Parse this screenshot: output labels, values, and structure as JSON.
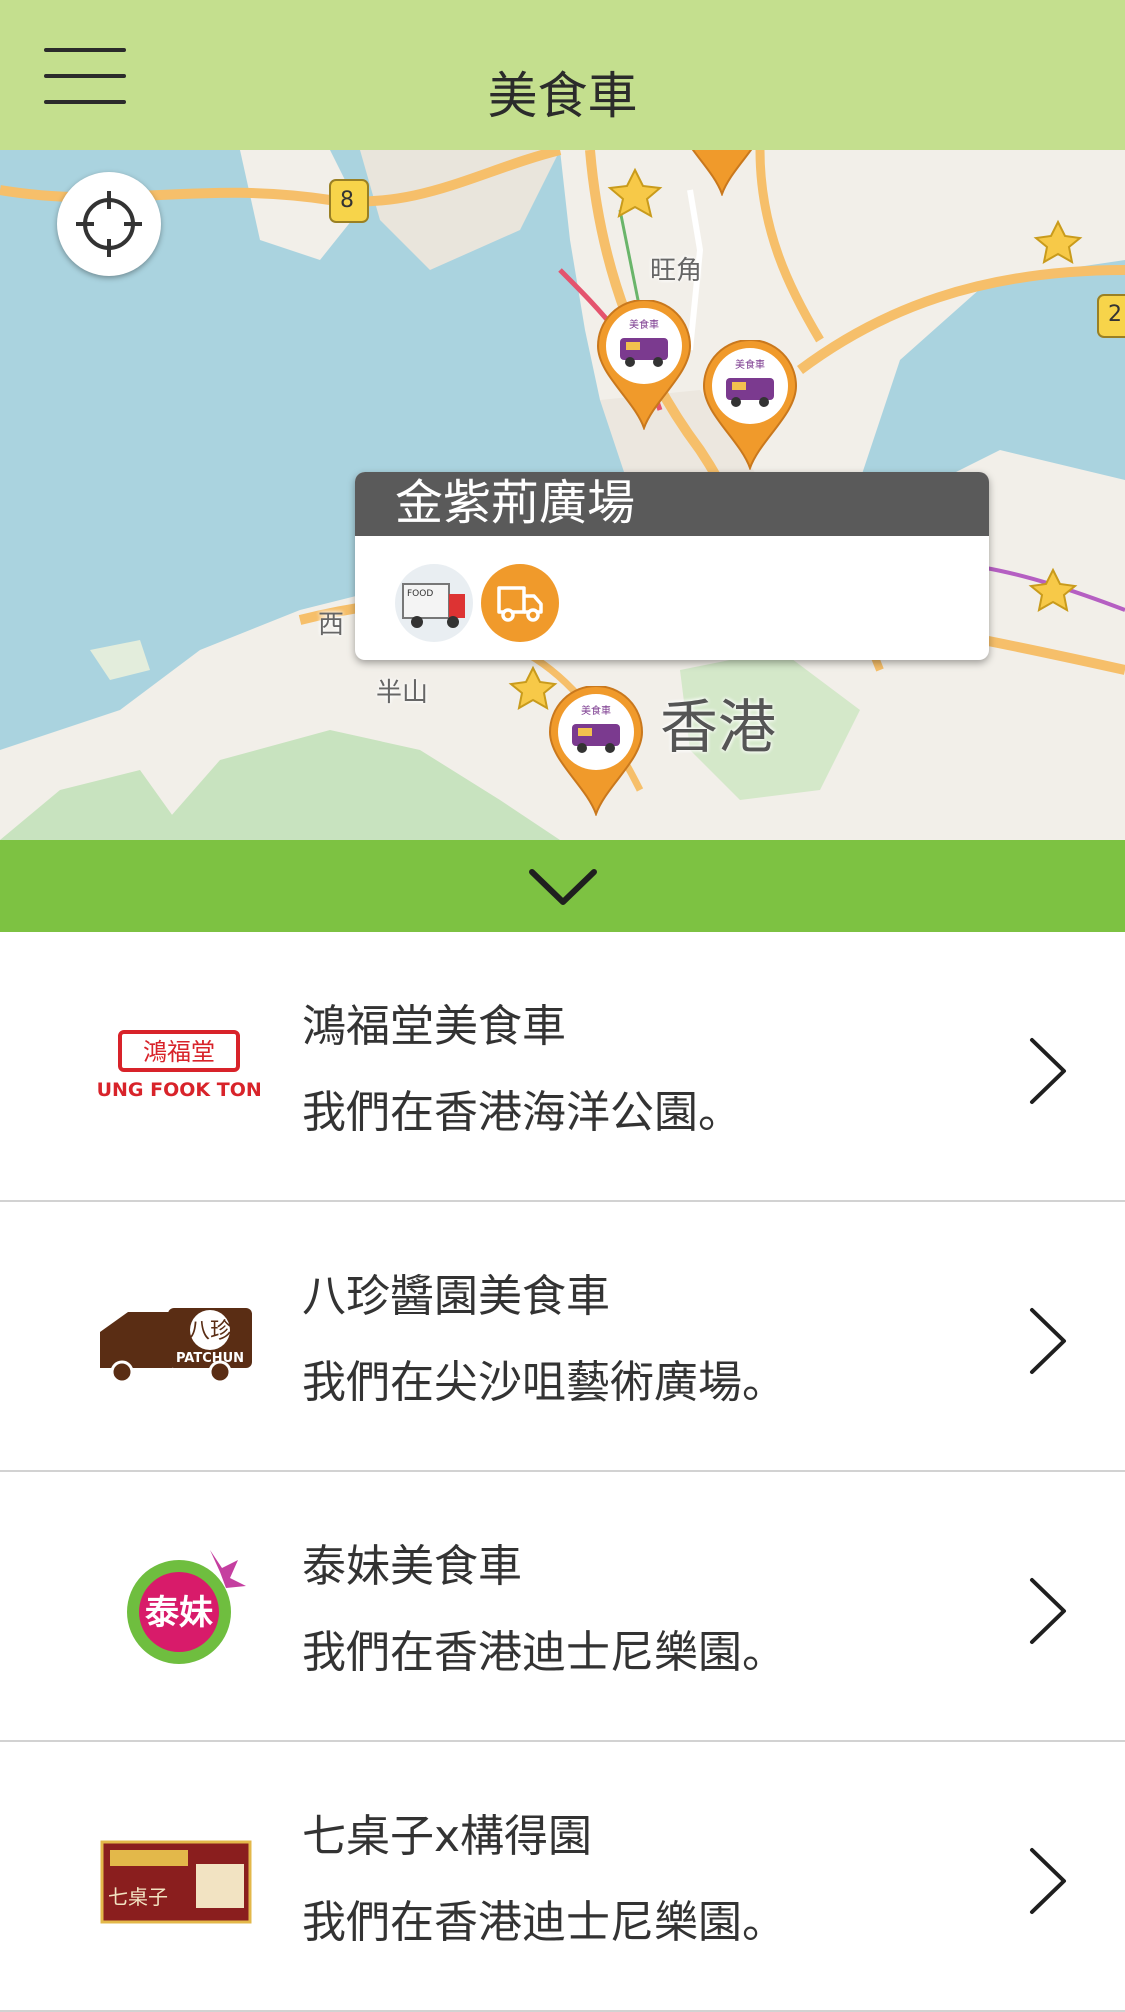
{
  "header": {
    "title": "美食車"
  },
  "map": {
    "place_labels": {
      "wang_kok": "旺角",
      "sai": "西",
      "bun_shan": "半山",
      "hong_kong": "香港"
    },
    "road_shield": "8",
    "road_shield_2": "2",
    "popup": {
      "title": "金紫荊廣場"
    },
    "colors": {
      "water": "#aad3df",
      "land": "#f2efe9",
      "park": "#c8e3bf",
      "road": "#f6bf6a",
      "pin": "#f09a2b"
    }
  },
  "toggle": {
    "icon": "chevron-down-icon"
  },
  "list": {
    "items": [
      {
        "name": "鴻福堂美食車",
        "location": "我們在香港海洋公園。",
        "logo": "hung-fook-tong-logo",
        "logo_text": "HUNG FOOK TONG"
      },
      {
        "name": "八珍醬園美食車",
        "location": "我們在尖沙咀藝術廣場。",
        "logo": "patchun-logo",
        "logo_text": "PATCHUN"
      },
      {
        "name": "泰妹美食車",
        "location": "我們在香港迪士尼樂園。",
        "logo": "thai-mui-logo",
        "logo_text": "泰妹"
      },
      {
        "name": "七桌子x構得園",
        "location": "我們在香港迪士尼樂園。",
        "logo": "seven-tables-logo",
        "logo_text": "七桌子"
      }
    ]
  },
  "colors": {
    "header_bg": "#c4df8e",
    "toggle_bg": "#7dc242",
    "divider": "#d2d2d2"
  }
}
